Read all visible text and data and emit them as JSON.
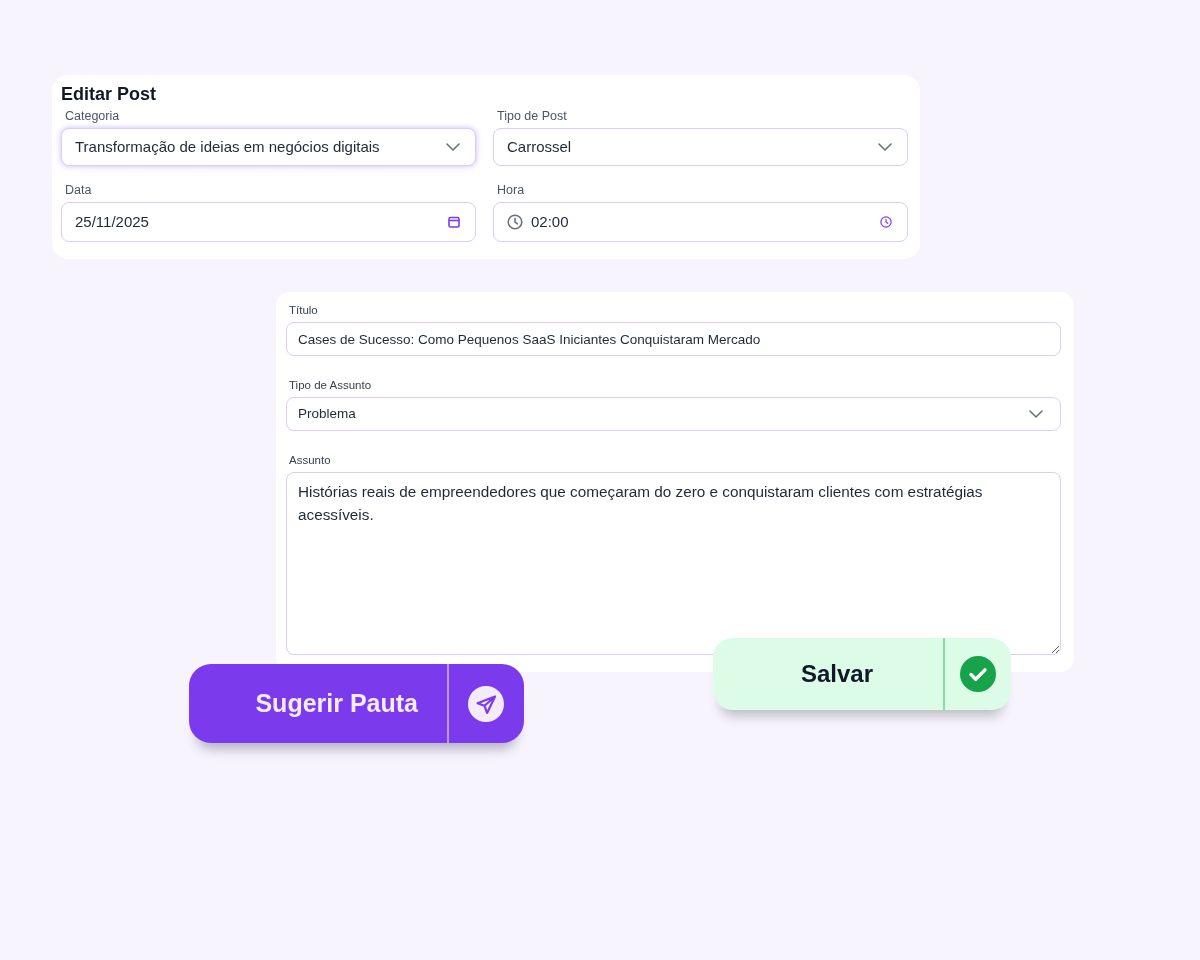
{
  "edit_post": {
    "title": "Editar Post",
    "fields": [
      {
        "kind": "select",
        "label": "Categoria",
        "value": "Transformação de ideias em negócios digitais",
        "focused": true
      },
      {
        "kind": "select",
        "label": "Tipo de Post",
        "value": "Carrossel",
        "focused": false
      },
      {
        "kind": "date",
        "label": "Data",
        "value": "25/11/2025",
        "focused": false
      },
      {
        "kind": "time",
        "label": "Hora",
        "value": "02:00",
        "focused": false
      }
    ]
  },
  "content": {
    "fields": [
      {
        "kind": "text",
        "label": "Título",
        "value": "Cases de Sucesso: Como Pequenos SaaS Iniciantes Conquistaram Mercado"
      },
      {
        "kind": "select",
        "label": "Tipo de Assunto",
        "value": "Problema"
      },
      {
        "kind": "textarea",
        "label": "Assunto",
        "value": "Histórias reais de empreendedores que começaram do zero e conquistaram clientes com estratégias acessíveis."
      }
    ]
  },
  "buttons": [
    {
      "kind": "suggest",
      "label": "Sugerir Pauta"
    },
    {
      "kind": "save",
      "label": "Salvar"
    }
  ]
}
